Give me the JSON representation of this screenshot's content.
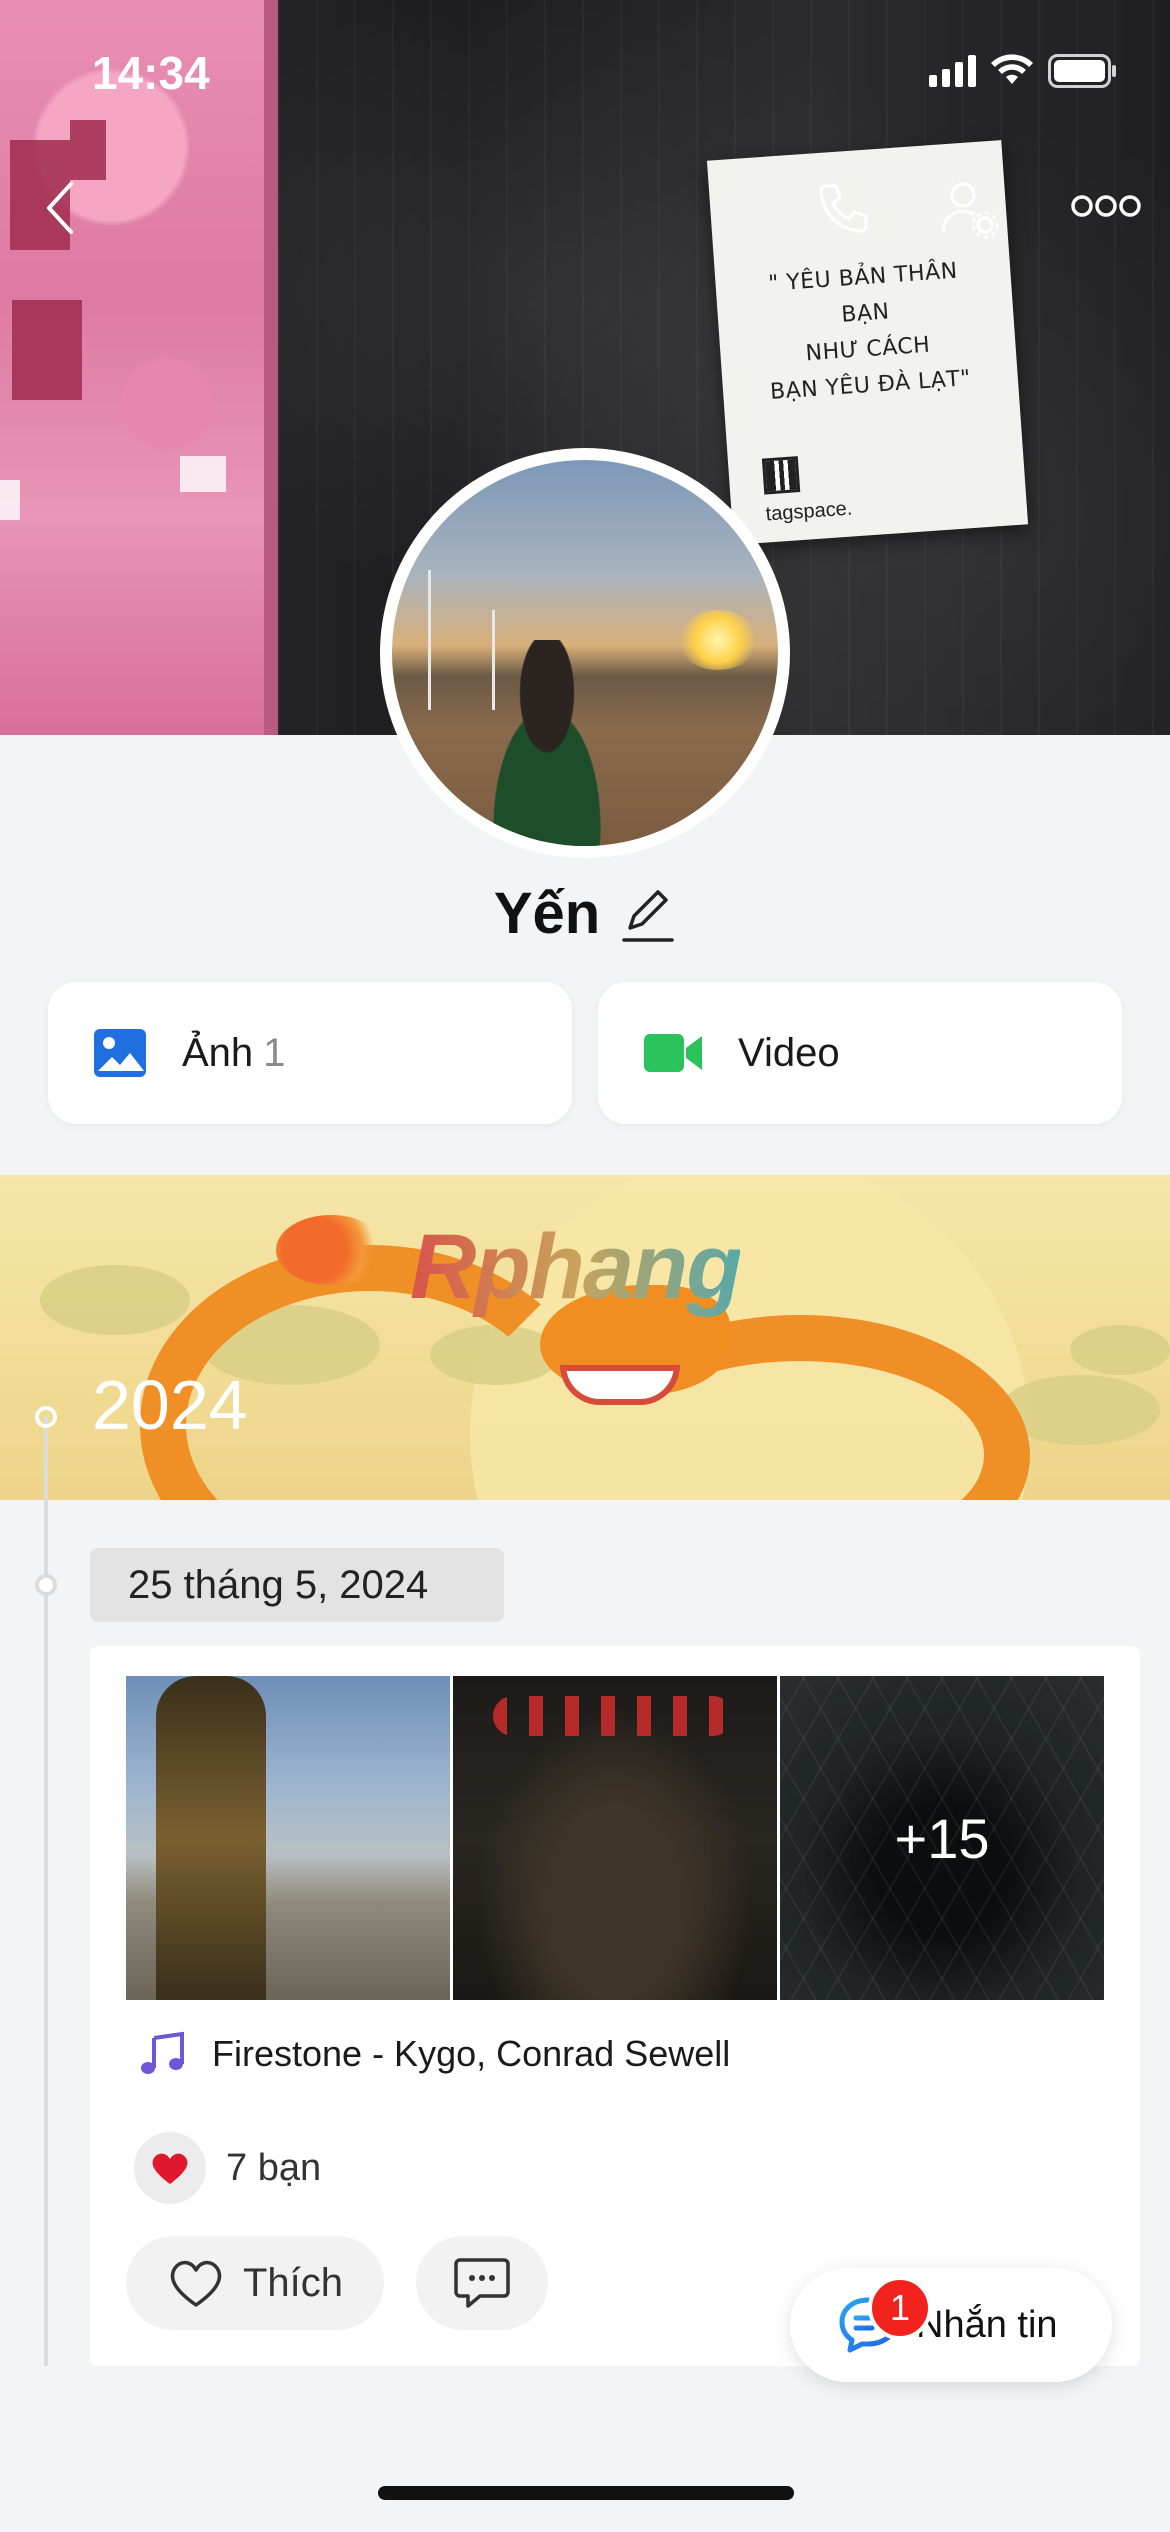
{
  "status_bar": {
    "time": "14:34"
  },
  "cover": {
    "poster_text": "\" YÊU BẢN THÂN BẠN\nNHƯ CÁCH\nBẠN YÊU ĐÀ LẠT\"",
    "poster_brand": "tagspace."
  },
  "profile": {
    "name": "Yến"
  },
  "media": {
    "photos_label": "Ảnh",
    "photos_count": "1",
    "video_label": "Video"
  },
  "timeline": {
    "year": "2024",
    "watermark": "Rphang",
    "date": "25 tháng 5, 2024",
    "post": {
      "more_photos": "+15",
      "song": "Firestone - Kygo, Conrad Sewell",
      "reactions": "7 bạn",
      "like_label": "Thích"
    }
  },
  "message_button": {
    "label": "Nhắn tin",
    "badge": "1"
  },
  "colors": {
    "accent_blue": "#1f6fe0",
    "video_green": "#29c25b",
    "badge_red": "#f2231c",
    "music_purple": "#6e56d6"
  }
}
